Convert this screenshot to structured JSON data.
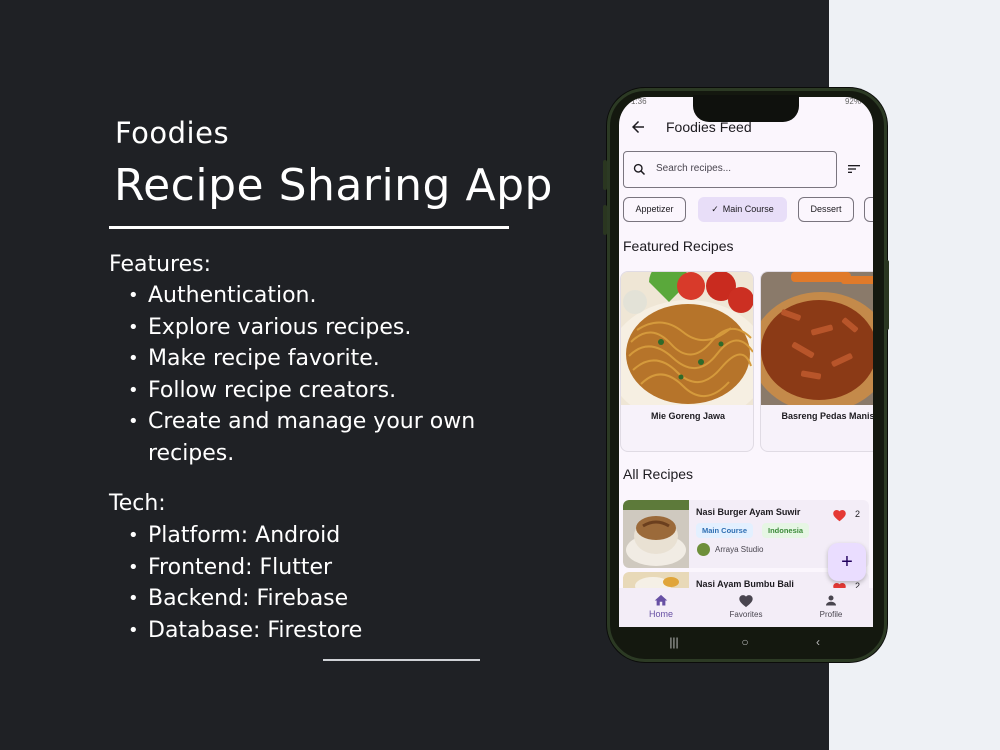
{
  "left": {
    "brand": "Foodies",
    "headline": "Recipe Sharing App",
    "features_title": "Features:",
    "features": [
      "Authentication.",
      "Explore various recipes.",
      "Make recipe favorite.",
      "Follow recipe creators.",
      "Create and manage your own recipes."
    ],
    "tech_title": "Tech:",
    "tech": [
      "Platform: Android",
      "Frontend: Flutter",
      "Backend: Firebase",
      "Database: Firestore"
    ]
  },
  "phone": {
    "status_time": "1:36",
    "status_battery": "92%",
    "app_bar": {
      "title": "Foodies Feed",
      "back_icon": "arrow-left-icon"
    },
    "search": {
      "placeholder": "Search recipes...",
      "icon": "search-icon",
      "filter_icon": "sort-icon"
    },
    "chips": [
      {
        "label": "Appetizer",
        "selected": false
      },
      {
        "label": "Main Course",
        "selected": true
      },
      {
        "label": "Dessert",
        "selected": false
      }
    ],
    "featured_title": "Featured Recipes",
    "featured": [
      {
        "name": "Mie Goreng Jawa"
      },
      {
        "name": "Basreng Pedas Manis"
      }
    ],
    "all_title": "All Recipes",
    "recipes": [
      {
        "name": "Nasi Burger Ayam Suwir",
        "course": "Main Course",
        "country": "Indonesia",
        "author": "Arraya Studio",
        "favorites": "2"
      },
      {
        "name": "Nasi Ayam Bumbu Bali",
        "favorites": "2"
      }
    ],
    "fab_label": "+",
    "nav": [
      {
        "label": "Home",
        "icon": "home-icon",
        "active": true
      },
      {
        "label": "Favorites",
        "icon": "heart-icon",
        "active": false
      },
      {
        "label": "Profile",
        "icon": "person-icon",
        "active": false
      }
    ],
    "colors": {
      "accent": "#6750a4",
      "heart": "#e53935",
      "chip_selected": "#e8def8"
    }
  }
}
